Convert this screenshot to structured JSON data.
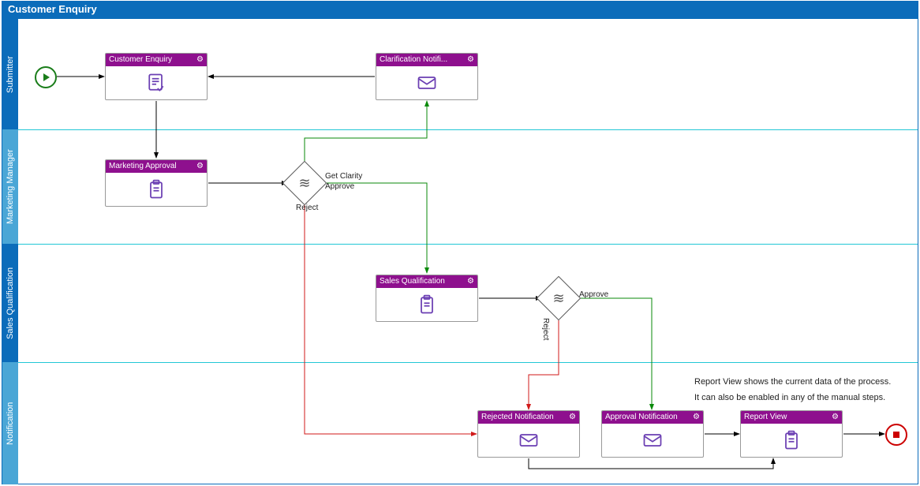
{
  "title": "Customer Enquiry",
  "lanes": {
    "submitter": "Submitter",
    "marketing": "Marketing Manager",
    "sales": "Sales Qualification",
    "notification": "Notification"
  },
  "tasks": {
    "customerEnquiry": {
      "label": "Customer Enquiry",
      "icon": "form"
    },
    "clarification": {
      "label": "Clarification Notifi...",
      "icon": "mail"
    },
    "marketingApproval": {
      "label": "Marketing Approval",
      "icon": "clipboard"
    },
    "salesQualification": {
      "label": "Sales Qualification",
      "icon": "clipboard"
    },
    "rejectedNotification": {
      "label": "Rejected Notification",
      "icon": "mail"
    },
    "approvalNotification": {
      "label": "Approval Notification",
      "icon": "mail"
    },
    "reportView": {
      "label": "Report View",
      "icon": "clipboard"
    }
  },
  "gatewayLabels": {
    "g1_getClarity": "Get Clarity",
    "g1_approve": "Approve",
    "g1_reject": "Reject",
    "g2_approve": "Approve",
    "g2_reject": "Reject"
  },
  "annotations": {
    "line1": "Report View shows the current data of the process.",
    "line2": "It can also be enabled in any of the manual steps."
  },
  "colors": {
    "titleBar": "#0b6cba",
    "laneBorder": "#22c7d6",
    "taskHeader": "#8e108e",
    "approve": "#0a8a0a",
    "reject": "#d11a1a",
    "default": "#000"
  }
}
